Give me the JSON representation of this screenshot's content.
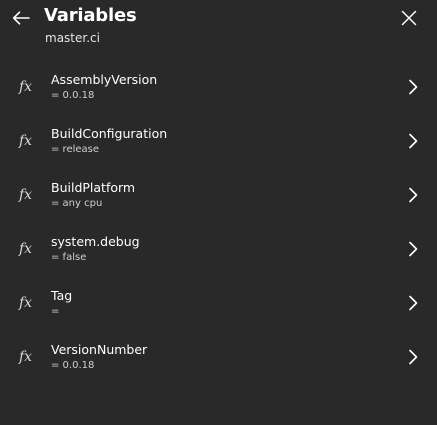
{
  "header": {
    "title": "Variables",
    "subtitle": "master.ci",
    "back_icon": "arrow-left-icon",
    "close_icon": "close-icon"
  },
  "variables": [
    {
      "icon": "fx",
      "name": "AssemblyVersion",
      "value": "= 0.0.18"
    },
    {
      "icon": "fx",
      "name": "BuildConfiguration",
      "value": "= release"
    },
    {
      "icon": "fx",
      "name": "BuildPlatform",
      "value": "= any cpu"
    },
    {
      "icon": "fx",
      "name": "system.debug",
      "value": "= false"
    },
    {
      "icon": "fx",
      "name": "Tag",
      "value": "="
    },
    {
      "icon": "fx",
      "name": "VersionNumber",
      "value": "= 0.0.18"
    }
  ],
  "colors": {
    "background": "#292929",
    "text": "#ffffff",
    "secondary_text": "#d0d0d0"
  }
}
